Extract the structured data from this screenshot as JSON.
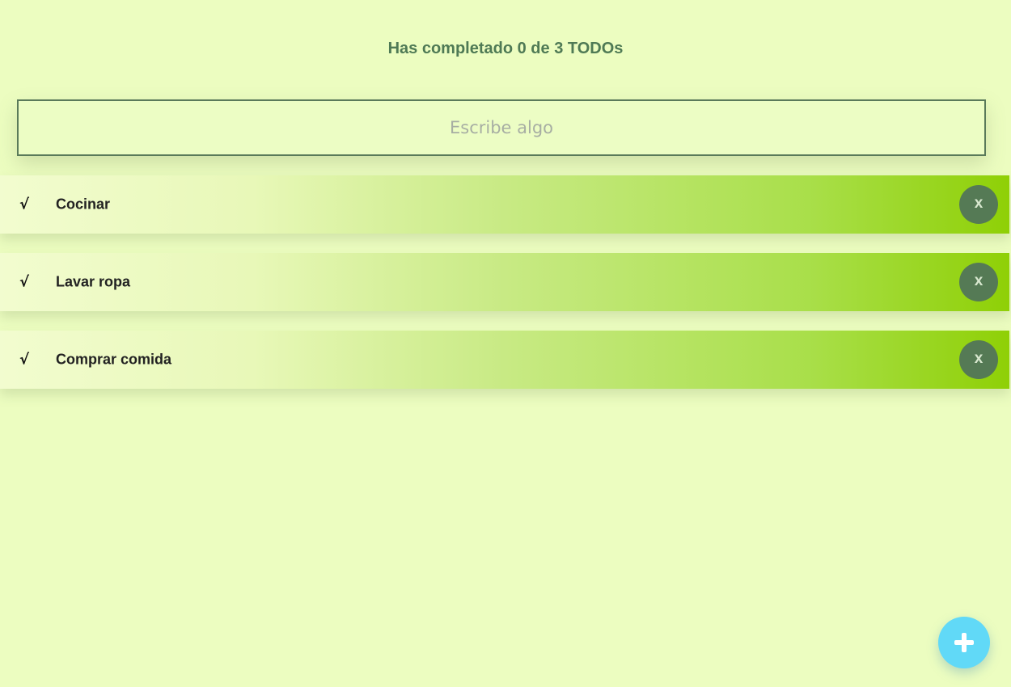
{
  "header": {
    "counter_text": "Has completado 0 de 3 TODOs"
  },
  "search": {
    "placeholder": "Escribe algo",
    "value": ""
  },
  "todos": [
    {
      "check": "√",
      "text": "Cocinar",
      "delete_label": "x"
    },
    {
      "check": "√",
      "text": "Lavar ropa",
      "delete_label": "x"
    },
    {
      "check": "√",
      "text": "Comprar comida",
      "delete_label": "x"
    }
  ],
  "fab": {
    "icon": "plus-icon"
  },
  "colors": {
    "background": "#ecfdc0",
    "accent_green": "#557a55",
    "fab_blue": "#61d9f7",
    "gradient_end": "#8fd006"
  }
}
